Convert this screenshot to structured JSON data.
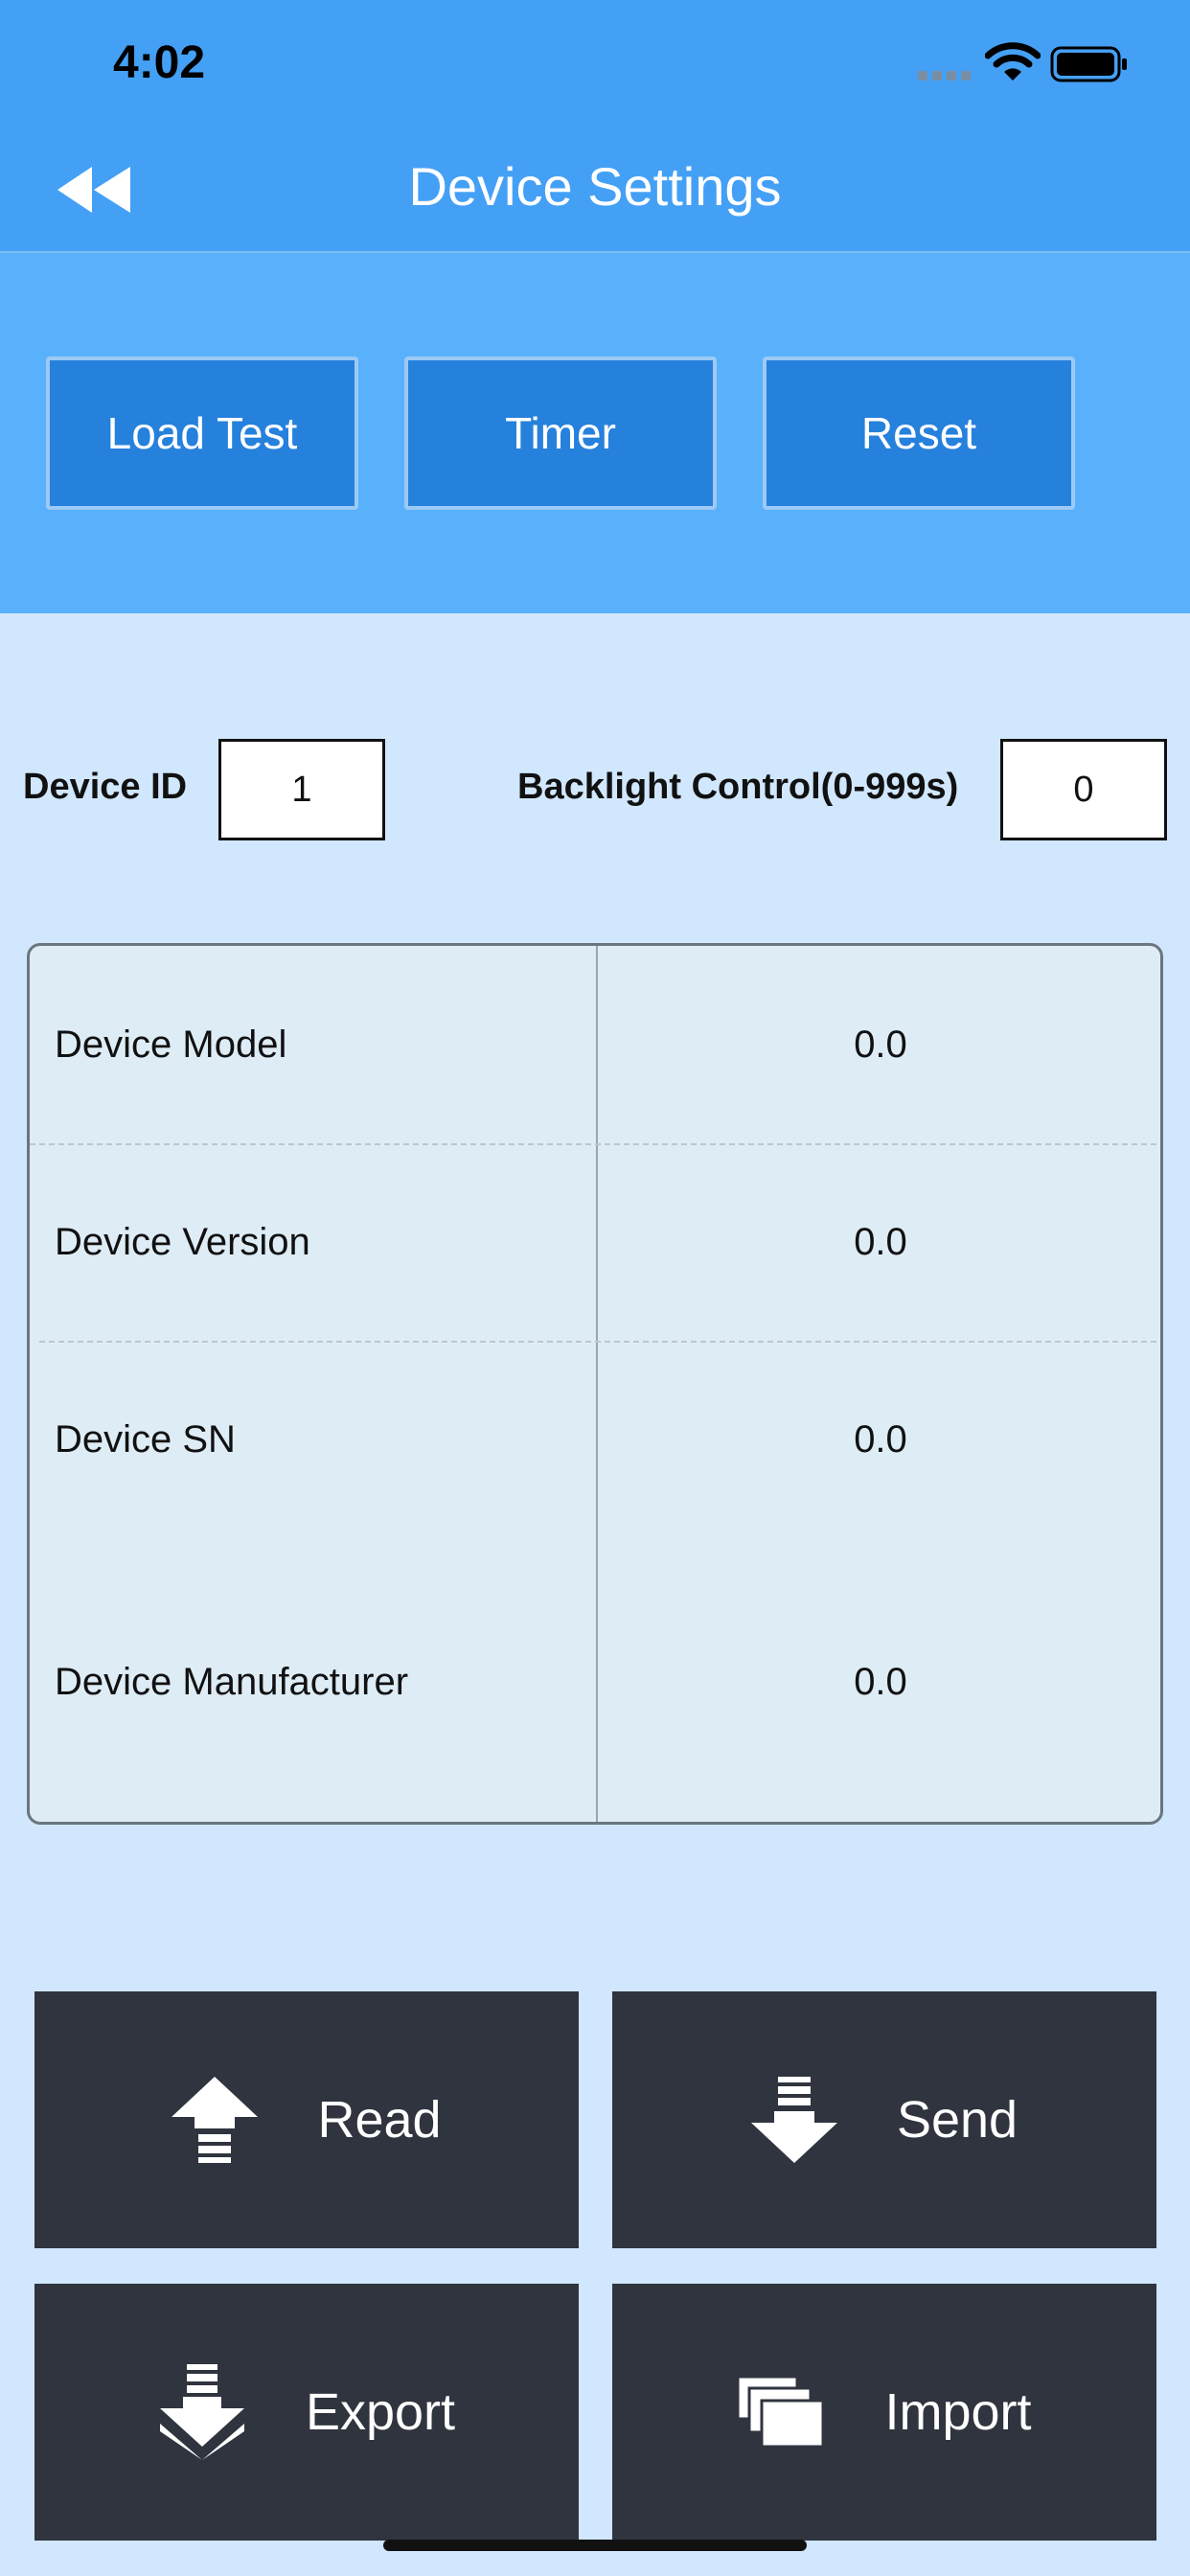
{
  "status_bar": {
    "time": "4:02"
  },
  "nav": {
    "title": "Device Settings",
    "back_icon": "double-chevron-left-icon"
  },
  "top_actions": [
    "Load Test",
    "Timer",
    "Reset"
  ],
  "fields": {
    "device_id": {
      "label": "Device ID",
      "value": "1"
    },
    "backlight": {
      "label": "Backlight Control(0-999s)",
      "value": "0"
    }
  },
  "info_rows": [
    {
      "label": "Device Model",
      "value": "0.0"
    },
    {
      "label": "Device Version",
      "value": "0.0"
    },
    {
      "label": "Device SN",
      "value": "0.0"
    },
    {
      "label": "Device Manufacturer",
      "value": "0.0"
    }
  ],
  "bottom_actions": {
    "read": {
      "label": "Read",
      "icon": "upload-arrow-icon"
    },
    "send": {
      "label": "Send",
      "icon": "download-arrow-icon"
    },
    "export": {
      "label": "Export",
      "icon": "export-arrow-icon"
    },
    "import": {
      "label": "Import",
      "icon": "stacked-cards-icon"
    }
  },
  "colors": {
    "nav_blue": "#44a0f5",
    "band_blue": "#5ab1fb",
    "button_blue": "#2581dc",
    "page_bg": "#d0e7fd",
    "dark_button": "#30343f"
  }
}
